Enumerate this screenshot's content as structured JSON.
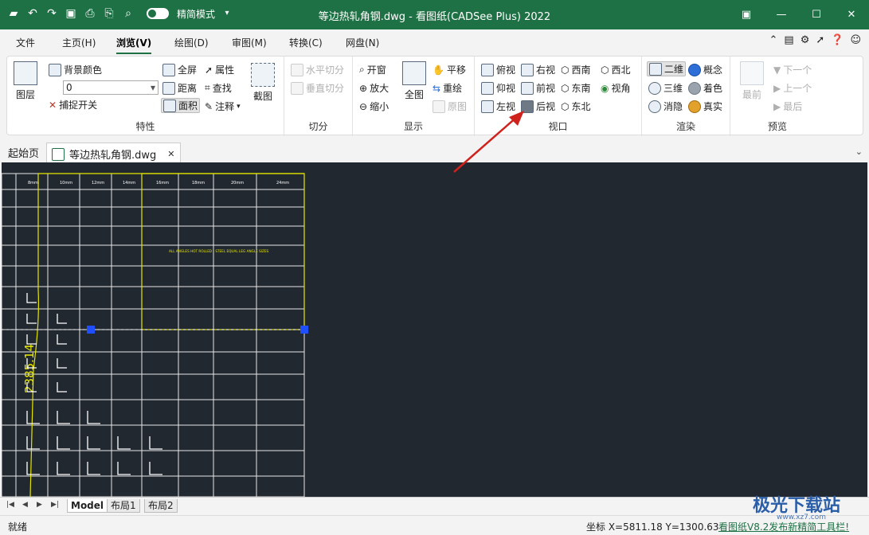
{
  "title_bar": {
    "simple_mode_label": "精简模式",
    "window_title": "等边热轧角钢.dwg - 看图纸(CADSee Plus) 2022",
    "controls": [
      "▣",
      "—",
      "☐",
      "✕"
    ]
  },
  "menu": {
    "tabs": [
      "文件",
      "主页(H)",
      "浏览(V)",
      "绘图(D)",
      "审图(M)",
      "转换(C)",
      "网盘(N)"
    ],
    "active_tab": "浏览(V)"
  },
  "ribbon": {
    "properties_group": {
      "label": "特性",
      "layer": "图层",
      "bg_color": "背景颜色",
      "layer_combo_value": "0",
      "snap": "捕捉开关",
      "fullscreen": "全屏",
      "attribute": "属性",
      "distance": "距离",
      "find": "查找",
      "area": "面积",
      "annotate": "注释",
      "screenshot": "截图"
    },
    "cut_group": {
      "label": "切分",
      "horizontal": "水平切分",
      "vertical": "垂直切分"
    },
    "display_group": {
      "label": "显示",
      "open_window": "开窗",
      "zoom_in": "放大",
      "zoom_out": "缩小",
      "full_view": "全图",
      "pan": "平移",
      "redraw": "重绘",
      "original": "原图"
    },
    "viewport_group": {
      "label": "视口",
      "top": "俯视",
      "bottom": "仰视",
      "left": "左视",
      "right": "右视",
      "front": "前视",
      "back": "后视",
      "sw": "西南",
      "se": "东南",
      "ne": "东北",
      "nw": "西北",
      "view_angle": "视角"
    },
    "render_group": {
      "label": "渲染",
      "two_d": "二维",
      "three_d": "三维",
      "hide": "消隐",
      "concept": "概念",
      "shade": "着色",
      "real": "真实"
    },
    "preview_group": {
      "label": "预览",
      "latest": "最前",
      "next": "下一个",
      "prev": "上一个",
      "last": "最后"
    }
  },
  "doc_tabs": {
    "start": "起始页",
    "file": "等边热轧角钢.dwg",
    "close": "✕",
    "more": "⌄"
  },
  "canvas": {
    "header_cells": [
      "8mm",
      "10mm",
      "12mm",
      "14mm",
      "16mm",
      "18mm",
      "20mm",
      "24mm"
    ],
    "yellow_label": "2385.14",
    "yellow_note": "ALL ANGLES HOT ROLLED - STEEL EQUAL LEG ANGLE SIZES"
  },
  "layout_tabs": [
    "Model",
    "布局1",
    "布局2"
  ],
  "status": {
    "ready": "就绪",
    "coords": "坐标 X=5811.18 Y=1300.63",
    "news": "看图纸V8.2发布新精简工具栏!"
  },
  "watermark": {
    "text": "极光下载站",
    "sub": "www.xz7.com"
  },
  "colors": {
    "titlebar": "#1e7145",
    "canvas": "#212830",
    "cad_yellow": "#e6e600",
    "grip_blue": "#1f4fff",
    "arrow_red": "#d0221c"
  }
}
